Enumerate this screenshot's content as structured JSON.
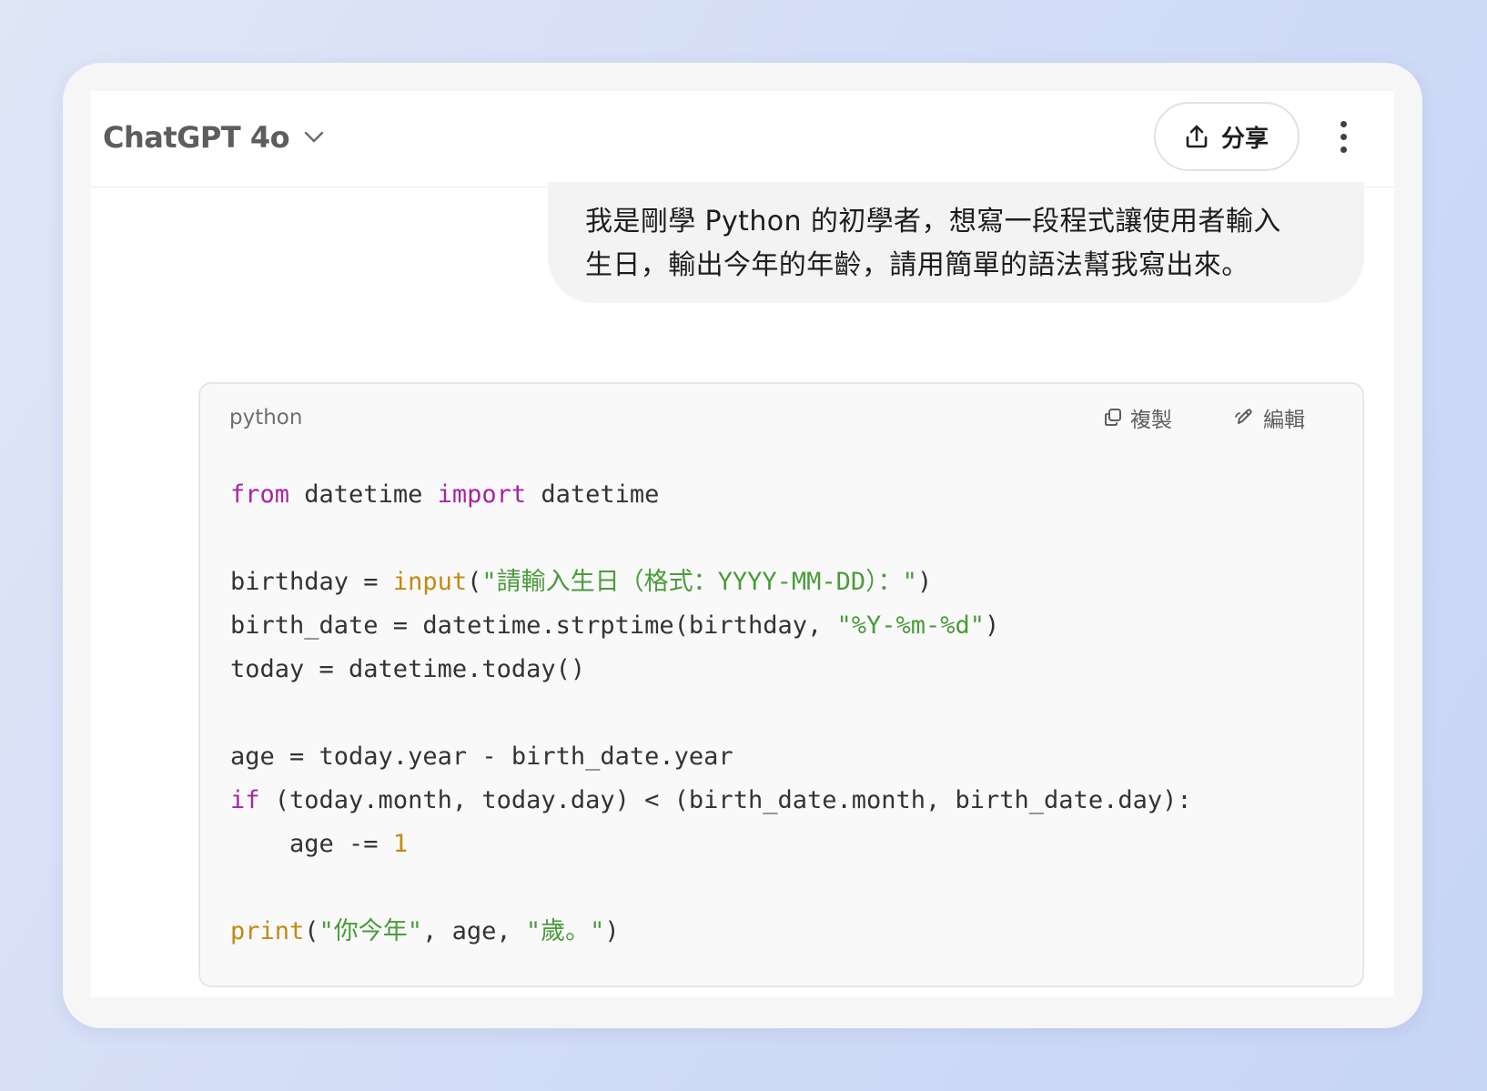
{
  "header": {
    "model_name": "ChatGPT 4o",
    "share_label": "分享"
  },
  "conversation": {
    "user_message_line1": "我是剛學 Python 的初學者，想寫一段程式讓使用者輸入",
    "user_message_line2": "生日，輸出今年的年齡，請用簡單的語法幫我寫出來。"
  },
  "code_block": {
    "language": "python",
    "copy_label": "複製",
    "edit_label": "編輯",
    "lines": [
      [
        {
          "t": "from",
          "c": "kw"
        },
        {
          "t": " datetime ",
          "c": ""
        },
        {
          "t": "import",
          "c": "kw"
        },
        {
          "t": " datetime",
          "c": ""
        }
      ],
      [],
      [
        {
          "t": "birthday = ",
          "c": ""
        },
        {
          "t": "input",
          "c": "fn"
        },
        {
          "t": "(",
          "c": ""
        },
        {
          "t": "\"請輸入生日（格式：YYYY-MM-DD）：\"",
          "c": "str"
        },
        {
          "t": ")",
          "c": ""
        }
      ],
      [
        {
          "t": "birth_date = datetime.strptime(birthday, ",
          "c": ""
        },
        {
          "t": "\"%Y-%m-%d\"",
          "c": "str"
        },
        {
          "t": ")",
          "c": ""
        }
      ],
      [
        {
          "t": "today = datetime.today()",
          "c": ""
        }
      ],
      [],
      [
        {
          "t": "age = today.year - birth_date.year",
          "c": ""
        }
      ],
      [
        {
          "t": "if",
          "c": "kw"
        },
        {
          "t": " (today.month, today.day) < (birth_date.month, birth_date.day):",
          "c": ""
        }
      ],
      [
        {
          "t": "    age -= ",
          "c": ""
        },
        {
          "t": "1",
          "c": "num"
        }
      ],
      [],
      [
        {
          "t": "print",
          "c": "fn"
        },
        {
          "t": "(",
          "c": ""
        },
        {
          "t": "\"你今年\"",
          "c": "str"
        },
        {
          "t": ", age, ",
          "c": ""
        },
        {
          "t": "\"歲。\"",
          "c": "str"
        },
        {
          "t": ")",
          "c": ""
        }
      ]
    ]
  },
  "colors": {
    "keyword": "#a526a4",
    "builtin": "#c28a13",
    "string": "#4a9b3a"
  }
}
